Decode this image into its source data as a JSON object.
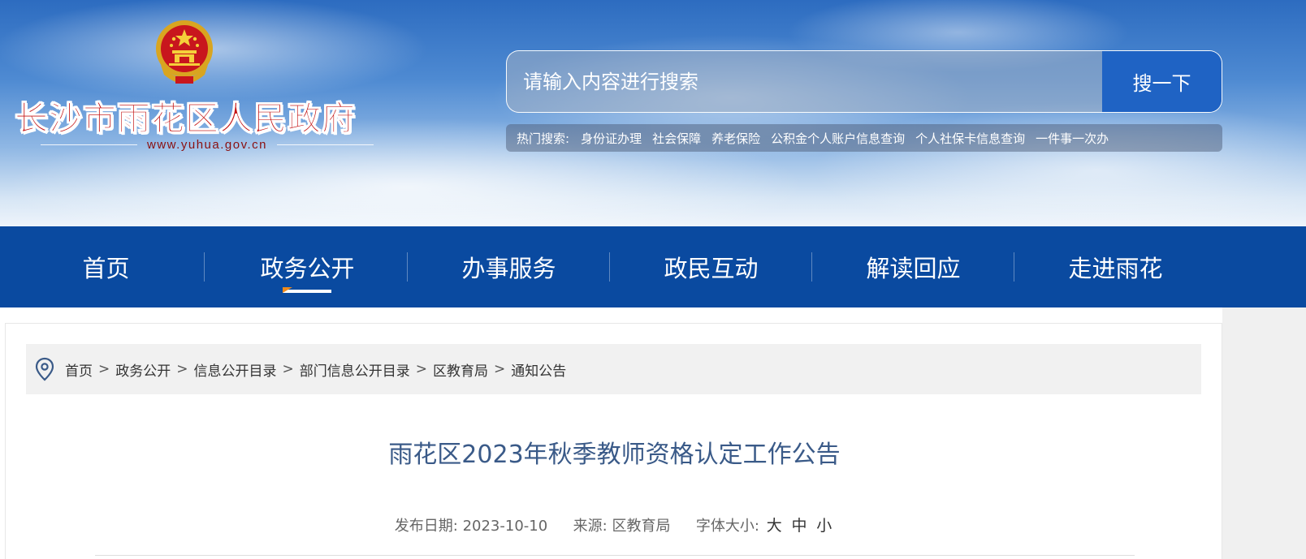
{
  "header": {
    "site_title": "长沙市雨花区人民政府",
    "site_url": "www.yuhua.gov.cn"
  },
  "search": {
    "placeholder": "请输入内容进行搜索",
    "button_label": "搜一下",
    "hot_label": "热门搜索:",
    "hot_terms": [
      "身份证办理",
      "社会保障",
      "养老保险",
      "公积金个人账户信息查询",
      "个人社保卡信息查询",
      "一件事一次办"
    ]
  },
  "nav": {
    "items": [
      "首页",
      "政务公开",
      "办事服务",
      "政民互动",
      "解读回应",
      "走进雨花"
    ],
    "active": "政务公开"
  },
  "breadcrumb": {
    "items": [
      "首页",
      "政务公开",
      "信息公开目录",
      "部门信息公开目录",
      "区教育局",
      "通知公告"
    ],
    "separator": ">"
  },
  "article": {
    "title": "雨花区2023年秋季教师资格认定工作公告",
    "date_label": "发布日期:",
    "date": "2023-10-10",
    "source_label": "来源:",
    "source": "区教育局",
    "font_size_label": "字体大小:",
    "font_sizes": [
      "大",
      "中",
      "小"
    ]
  },
  "colors": {
    "nav_background": "#0a4aa0",
    "search_button": "#1f63c4",
    "title_red": "#c41414",
    "article_title": "#3a5a88"
  }
}
